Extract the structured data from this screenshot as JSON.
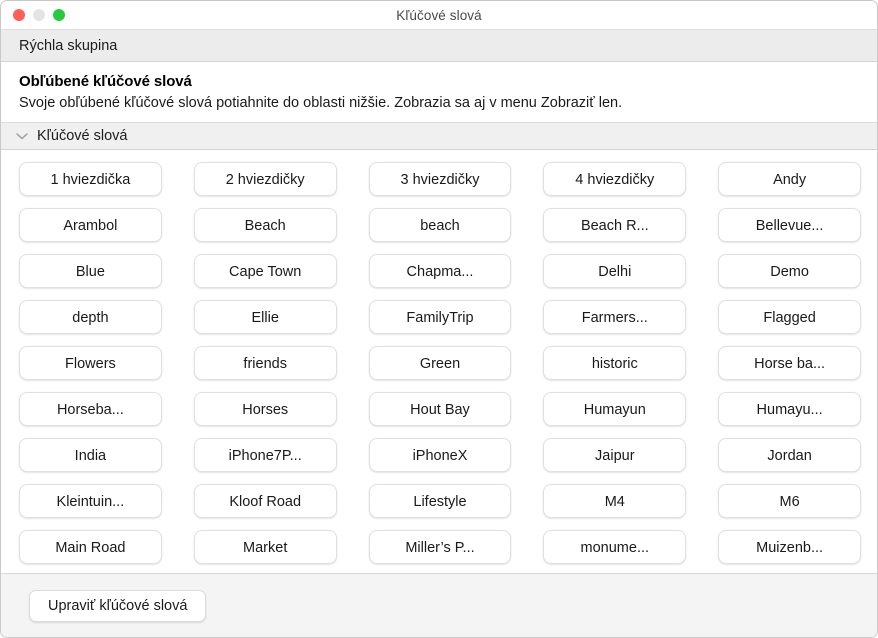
{
  "window": {
    "title": "Kľúčové slová",
    "traffic_lights": [
      {
        "name": "close",
        "color": "#ff5f56"
      },
      {
        "name": "minimize",
        "color": "#e4e4e4"
      },
      {
        "name": "zoom",
        "color": "#27c93f"
      }
    ]
  },
  "quick_group": {
    "label": "Rýchla skupina"
  },
  "favourites": {
    "title": "Obľúbené kľúčové slová",
    "description": "Svoje obľúbené kľúčové slová potiahnite do oblasti nižšie. Zobrazia sa aj v menu Zobraziť len."
  },
  "section": {
    "label": "Kľúčové slová",
    "chevron_icon": "chevron-down-icon",
    "expanded": true
  },
  "keywords": [
    "1 hviezdička",
    "2 hviezdičky",
    "3 hviezdičky",
    "4 hviezdičky",
    "Andy",
    "Arambol",
    "Beach",
    "beach",
    "Beach R...",
    "Bellevue...",
    "Blue",
    "Cape Town",
    "Chapma...",
    "Delhi",
    "Demo",
    "depth",
    "Ellie",
    "FamilyTrip",
    "Farmers...",
    "Flagged",
    "Flowers",
    "friends",
    "Green",
    "historic",
    "Horse ba...",
    "Horseba...",
    "Horses",
    "Hout Bay",
    "Humayun",
    "Humayu...",
    "India",
    "iPhone7P...",
    "iPhoneX",
    "Jaipur",
    "Jordan",
    "Kleintuin...",
    "Kloof Road",
    "Lifestyle",
    "M4",
    "M6",
    "Main Road",
    "Market",
    "Miller’s P...",
    "monume...",
    "Muizenb..."
  ],
  "footer": {
    "edit_label": "Upraviť kľúčové slová"
  }
}
